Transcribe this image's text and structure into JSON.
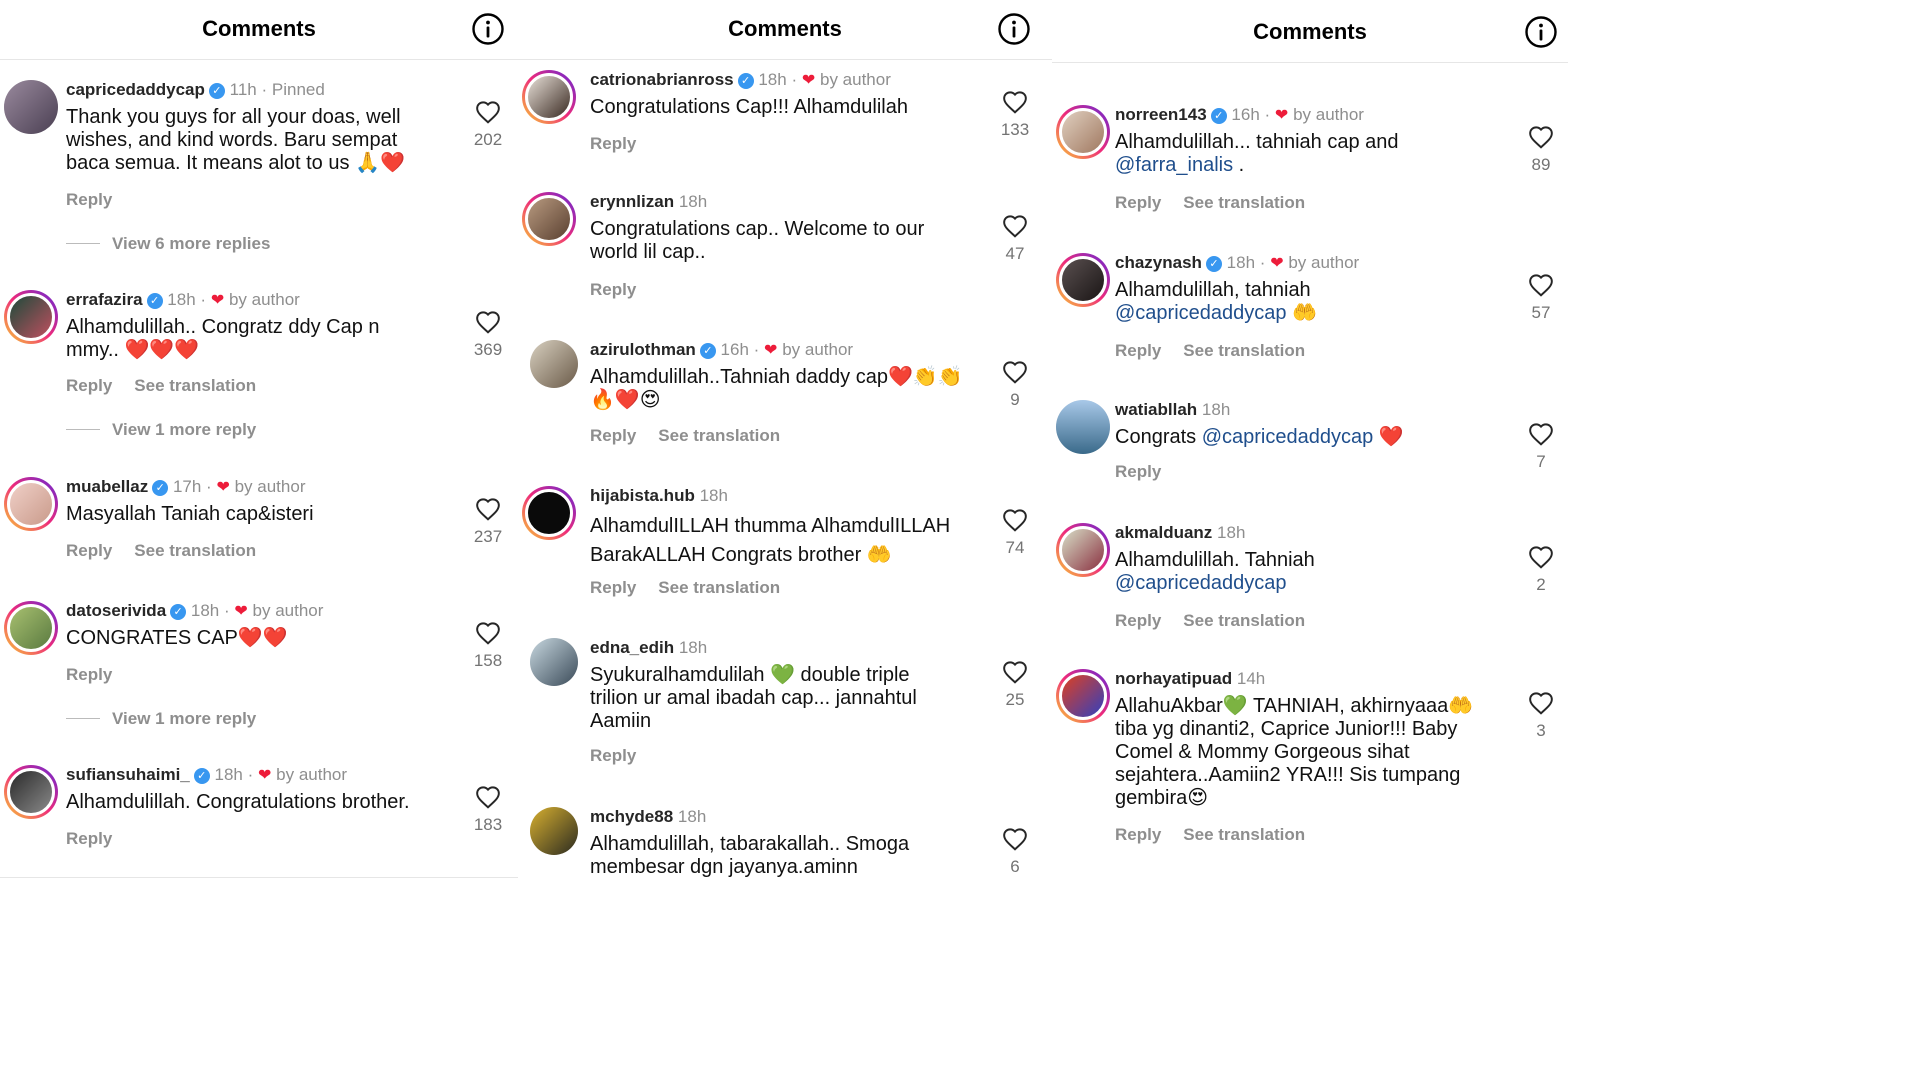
{
  "panels": [
    {
      "title": "Comments",
      "comments": [
        {
          "username": "capricedaddycap",
          "verified": true,
          "time": "11h",
          "tag": "Pinned",
          "by_author": false,
          "text": "Thank you guys for all your doas, well wishes, and kind words. Baru sempat baca semua. It means alot to us 🙏❤️",
          "actions": [
            "Reply"
          ],
          "more": "View 6 more replies",
          "likes": "202"
        },
        {
          "username": "errafazira",
          "verified": true,
          "time": "18h",
          "tag": "",
          "by_author": true,
          "text": "Alhamdulillah.. Congratz ddy Cap n mmy.. ❤️❤️❤️",
          "actions": [
            "Reply",
            "See translation"
          ],
          "more": "View 1 more reply",
          "likes": "369"
        },
        {
          "username": "muabellaz",
          "verified": true,
          "time": "17h",
          "tag": "",
          "by_author": true,
          "text": "Masyallah Taniah cap&isteri",
          "actions": [
            "Reply",
            "See translation"
          ],
          "more": "",
          "likes": "237"
        },
        {
          "username": "datoserivida",
          "verified": true,
          "time": "18h",
          "tag": "",
          "by_author": true,
          "text": "CONGRATES CAP❤️❤️",
          "actions": [
            "Reply"
          ],
          "more": "View 1 more reply",
          "likes": "158"
        },
        {
          "username": "sufiansuhaimi_",
          "verified": true,
          "time": "18h",
          "tag": "",
          "by_author": true,
          "text": "Alhamdulillah. Congratulations brother.",
          "actions": [
            "Reply"
          ],
          "more": "",
          "likes": "183"
        }
      ]
    },
    {
      "title": "Comments",
      "comments": [
        {
          "username": "catrionabrianross",
          "verified": true,
          "time": "18h",
          "by_author": true,
          "text": "Congratulations Cap!!! Alhamdulilah",
          "actions": [
            "Reply"
          ],
          "likes": "133"
        },
        {
          "username": "erynnlizan",
          "verified": false,
          "time": "18h",
          "by_author": false,
          "text": "Congratulations cap.. Welcome to our world lil cap..",
          "actions": [
            "Reply"
          ],
          "likes": "47"
        },
        {
          "username": "azirulothman",
          "verified": true,
          "time": "16h",
          "by_author": true,
          "text": "Alhamdulillah..Tahniah daddy cap❤️👏👏🔥❤️😍",
          "actions": [
            "Reply",
            "See translation"
          ],
          "likes": "9"
        },
        {
          "username": "hijabista.hub",
          "verified": false,
          "time": "18h",
          "by_author": false,
          "text": "AlhamdulILLAH thumma AlhamdulILLAH BarakALLAH Congrats brother 🤲",
          "actions": [
            "Reply",
            "See translation"
          ],
          "likes": "74"
        },
        {
          "username": "edna_edih",
          "verified": false,
          "time": "18h",
          "by_author": false,
          "text": "Syukuralhamdulilah 💚 double triple trilion ur amal ibadah cap... jannahtul Aamiin",
          "actions": [
            "Reply"
          ],
          "likes": "25"
        },
        {
          "username": "mchyde88",
          "verified": false,
          "time": "18h",
          "by_author": false,
          "text": "Alhamdulillah,  tabarakallah.. Smoga membesar dgn jayanya.aminn",
          "actions": [],
          "likes": "6"
        }
      ]
    },
    {
      "title": "Comments",
      "comments": [
        {
          "username": "norreen143",
          "verified": true,
          "time": "16h",
          "by_author": true,
          "text_before": "Alhamdulillah... tahniah cap and ",
          "mention": "@farra_inalis",
          "text_after": " .",
          "actions": [
            "Reply",
            "See translation"
          ],
          "likes": "89"
        },
        {
          "username": "chazynash",
          "verified": true,
          "time": "18h",
          "by_author": true,
          "text_before": "Alhamdulillah, tahniah ",
          "mention": "@capricedaddycap",
          "text_after": " 🤲",
          "actions": [
            "Reply",
            "See translation"
          ],
          "likes": "57"
        },
        {
          "username": "watiabllah",
          "verified": false,
          "time": "18h",
          "by_author": false,
          "text_before": "Congrats ",
          "mention": "@capricedaddycap",
          "text_after": " ❤️",
          "actions": [
            "Reply"
          ],
          "likes": "7"
        },
        {
          "username": "akmalduanz",
          "verified": false,
          "time": "18h",
          "by_author": false,
          "text_before": "Alhamdulillah. Tahniah ",
          "mention": "@capricedaddycap",
          "text_after": "",
          "actions": [
            "Reply",
            "See translation"
          ],
          "likes": "2"
        },
        {
          "username": "norhayatipuad",
          "verified": false,
          "time": "14h",
          "by_author": false,
          "text_before": "AllahuAkbar💚 TAHNIAH, akhirnyaaa🤲 tiba yg dinanti2, Caprice Junior!!! Baby Comel & Mommy Gorgeous sihat sejahtera..Aamiin2 YRA!!! Sis tumpang gembira😍",
          "mention": "",
          "text_after": "",
          "actions": [
            "Reply",
            "See translation"
          ],
          "likes": "3"
        }
      ]
    }
  ],
  "labels": {
    "by_author": "by author",
    "separator": "·"
  },
  "colors": {
    "accent_blue": "#3897f0",
    "heart_red": "#ed1c3a",
    "mention": "#1f4e8c",
    "muted": "#8e8e8e"
  },
  "icons": {
    "info": "info-icon",
    "like": "heart-outline-icon",
    "verified": "verified-badge-icon",
    "author_heart": "red-heart-icon"
  }
}
